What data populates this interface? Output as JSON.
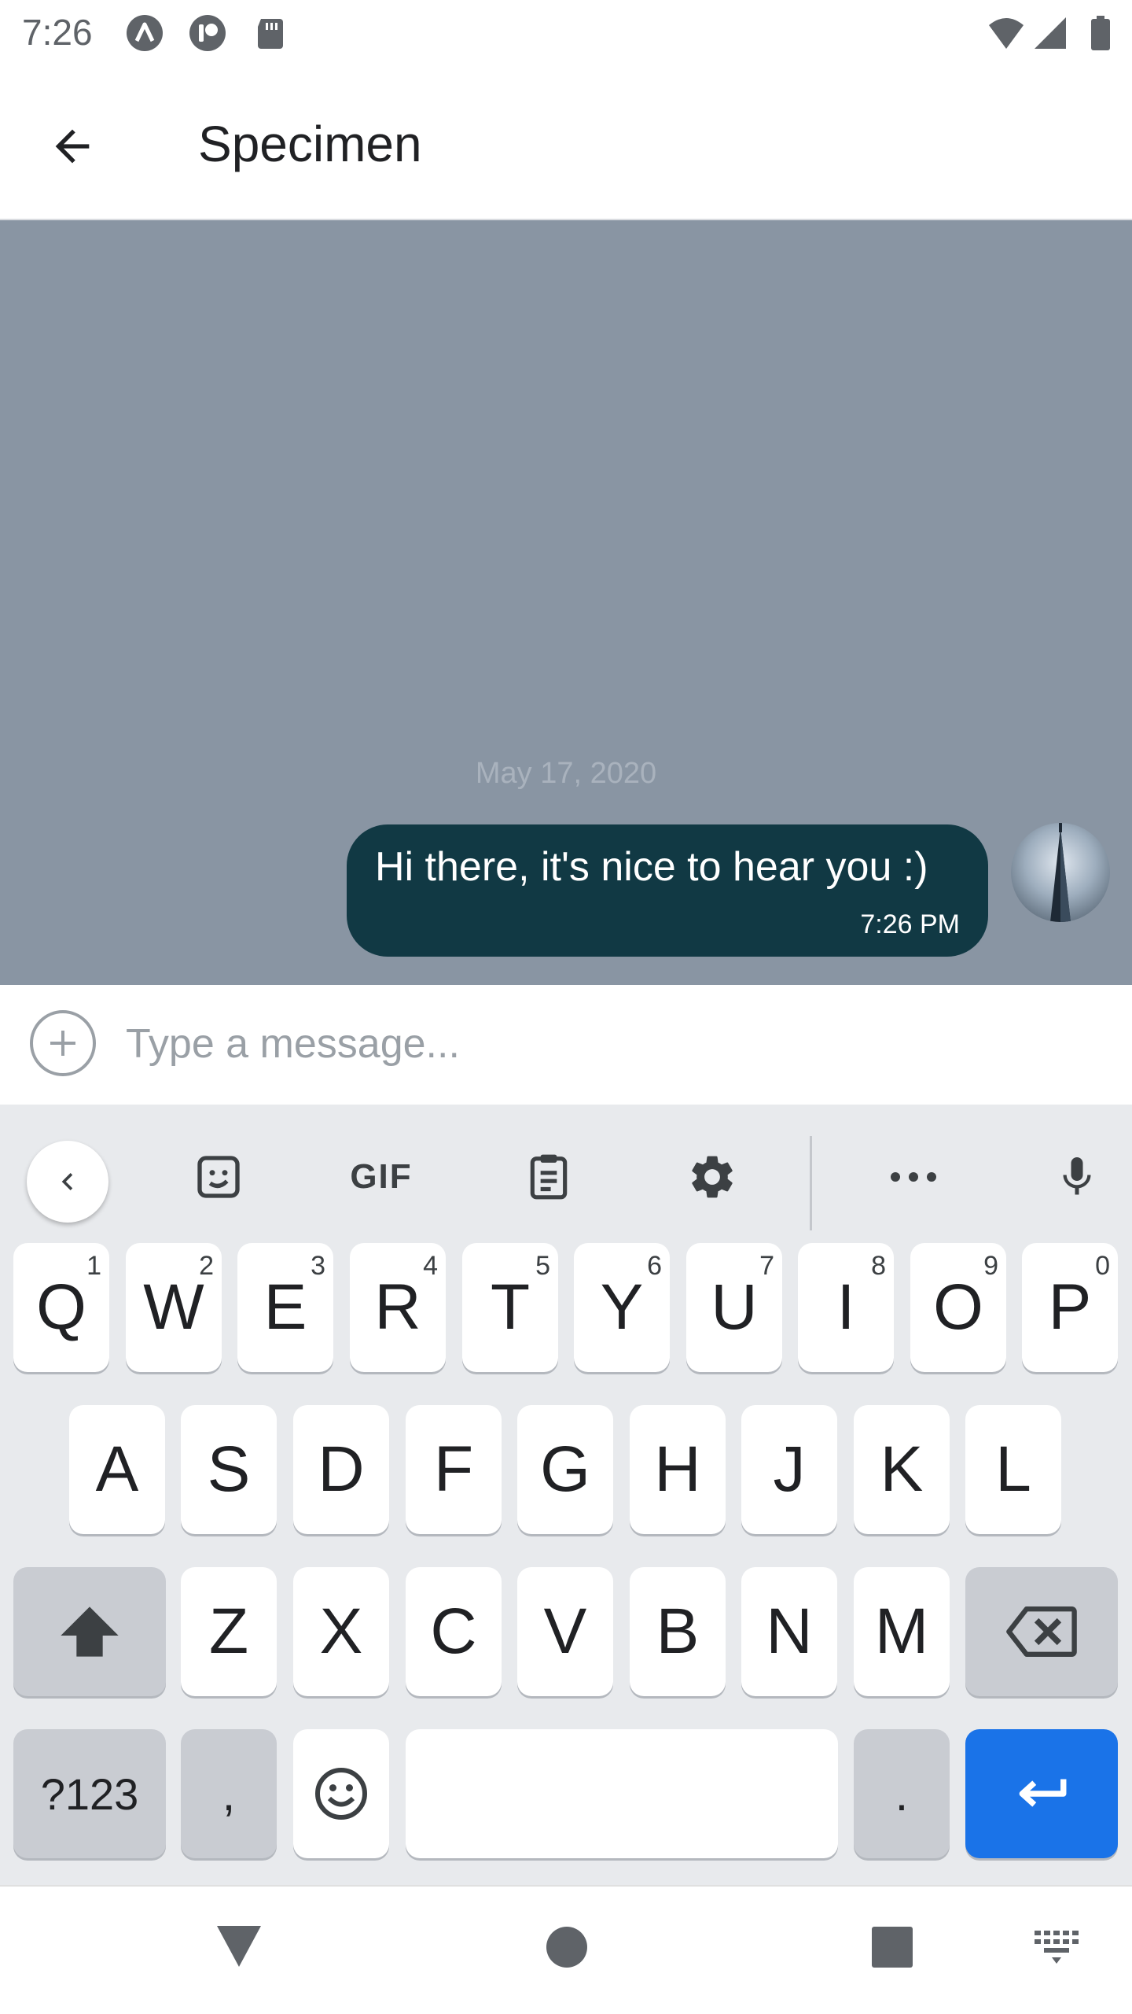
{
  "status_bar": {
    "time": "7:26",
    "icons": [
      "arc-app-icon",
      "notification-app-icon",
      "sd-card-icon",
      "wifi-icon",
      "signal-icon",
      "battery-icon"
    ]
  },
  "app_bar": {
    "title": "Specimen",
    "back_icon": "arrow-back-icon"
  },
  "chat": {
    "background_color": "#8995a3",
    "date_divider": "May 17, 2020",
    "messages": [
      {
        "text": "Hi there, it's nice to hear you :)",
        "time": "7:26 PM",
        "bubble_color": "#113944"
      }
    ]
  },
  "composer": {
    "placeholder": "Type a message...",
    "value": "",
    "add_icon": "add-circle-icon"
  },
  "keyboard": {
    "toolbar": {
      "items": [
        "chevron-left-icon",
        "sticker-icon",
        "gif-icon",
        "clipboard-icon",
        "settings-icon",
        "more-icon",
        "mic-icon"
      ],
      "gif_label": "GIF"
    },
    "row1": [
      {
        "label": "Q",
        "hint": "1"
      },
      {
        "label": "W",
        "hint": "2"
      },
      {
        "label": "E",
        "hint": "3"
      },
      {
        "label": "R",
        "hint": "4"
      },
      {
        "label": "T",
        "hint": "5"
      },
      {
        "label": "Y",
        "hint": "6"
      },
      {
        "label": "U",
        "hint": "7"
      },
      {
        "label": "I",
        "hint": "8"
      },
      {
        "label": "O",
        "hint": "9"
      },
      {
        "label": "P",
        "hint": "0"
      }
    ],
    "row2": [
      "A",
      "S",
      "D",
      "F",
      "G",
      "H",
      "J",
      "K",
      "L"
    ],
    "row3": [
      "Z",
      "X",
      "C",
      "V",
      "B",
      "N",
      "M"
    ],
    "symbols_label": "?123",
    "comma_label": ",",
    "period_label": ".",
    "enter_color": "#1a73e8"
  },
  "nav_bar": {
    "icons": [
      "back-triangle-icon",
      "home-circle-icon",
      "recents-square-icon",
      "keyboard-switch-icon"
    ]
  }
}
